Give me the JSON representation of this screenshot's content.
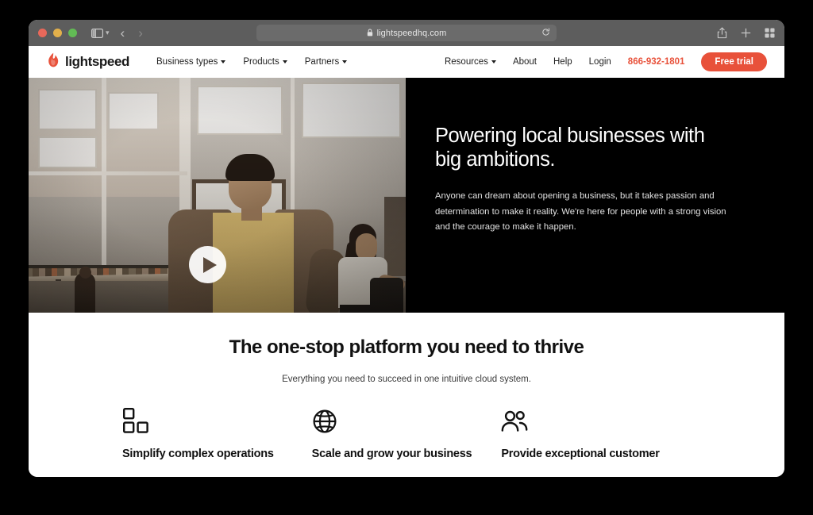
{
  "browser": {
    "traffic_lights": [
      "close",
      "minimize",
      "maximize"
    ],
    "sidebar_toggle_label": "Sidebar",
    "back_label": "Back",
    "forward_label": "Forward",
    "privacy_label": "Privacy Report",
    "url": "lightspeedhq.com",
    "reload_label": "Reload",
    "share_label": "Share",
    "new_tab_label": "New Tab",
    "tab_overview_label": "Tab Overview",
    "colors": {
      "toolbar": "#5d5d5d",
      "urlbar": "#6b6b6b",
      "close": "#e8685a",
      "minimize": "#e3b04b",
      "maximize": "#62bb55"
    }
  },
  "site_nav": {
    "brand": "lightspeed",
    "left_items": [
      {
        "label": "Business types",
        "has_caret": true
      },
      {
        "label": "Products",
        "has_caret": true
      },
      {
        "label": "Partners",
        "has_caret": true
      }
    ],
    "right_items": [
      {
        "label": "Resources",
        "has_caret": true
      },
      {
        "label": "About",
        "has_caret": false
      },
      {
        "label": "Help",
        "has_caret": false
      },
      {
        "label": "Login",
        "has_caret": false
      }
    ],
    "phone": "866-932-1801",
    "cta": "Free trial",
    "accent_color": "#e8513a"
  },
  "hero": {
    "play_button_label": "Play video",
    "title": "Powering local businesses with big ambitions.",
    "body": "Anyone can dream about opening a business, but it takes passion and determination to make it reality. We're here for people with a strong vision and the courage to make it happen.",
    "background_color": "#000000"
  },
  "features": {
    "title": "The one-stop platform you need to thrive",
    "subtitle": "Everything you need to succeed in one intuitive cloud system.",
    "items": [
      {
        "icon": "blocks-icon",
        "label": "Simplify complex operations"
      },
      {
        "icon": "globe-icon",
        "label": "Scale and grow your business"
      },
      {
        "icon": "people-icon",
        "label": "Provide exceptional customer"
      }
    ]
  }
}
